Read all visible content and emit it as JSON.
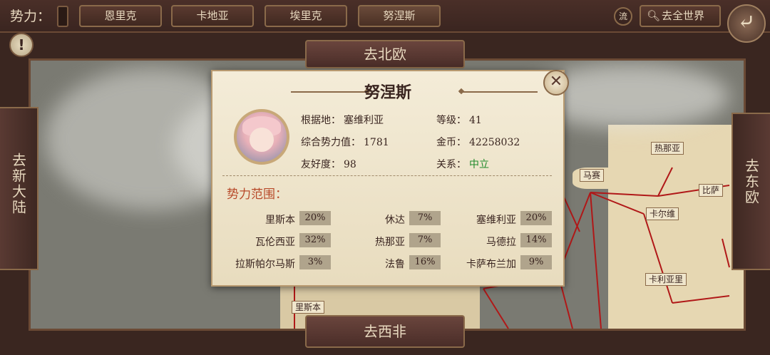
{
  "topbar": {
    "faction_label": "势力：",
    "tabs": [
      "恩里克",
      "卡地亚",
      "埃里克",
      "努涅斯"
    ],
    "flow_label": "流",
    "world_button": "去全世界",
    "search_icon": "search-icon",
    "back_icon": "back-arrow-icon"
  },
  "alert": {
    "label": "!"
  },
  "nav": {
    "north": "去北欧",
    "south": "去西非",
    "west": "去新大陆",
    "east": "去东欧"
  },
  "map_labels": {
    "marseille": "马赛",
    "genoa": "热那亚",
    "pisa": "比萨",
    "cagliari": "卡尔维",
    "cagliari2": "卡利亚里",
    "lisbon": "里斯本"
  },
  "popup": {
    "title": "努涅斯",
    "base_label": "根据地：",
    "base_value": "塞维利亚",
    "power_label": "综合势力值：",
    "power_value": "1781",
    "friend_label": "友好度：",
    "friend_value": "98",
    "level_label": "等级：",
    "level_value": "41",
    "gold_label": "金币：",
    "gold_value": "42258032",
    "relation_label": "关系：",
    "relation_value": "中立",
    "range_title": "势力范围：",
    "ranges": [
      {
        "name": "里斯本",
        "value": "20%"
      },
      {
        "name": "休达",
        "value": "7%"
      },
      {
        "name": "塞维利亚",
        "value": "20%"
      },
      {
        "name": "瓦伦西亚",
        "value": "32%"
      },
      {
        "name": "热那亚",
        "value": "7%"
      },
      {
        "name": "马德拉",
        "value": "14%"
      },
      {
        "name": "拉斯帕尔马斯",
        "value": "3%"
      },
      {
        "name": "法鲁",
        "value": "16%"
      },
      {
        "name": "卡萨布兰加",
        "value": "9%"
      }
    ],
    "close_icon": "close-icon"
  }
}
